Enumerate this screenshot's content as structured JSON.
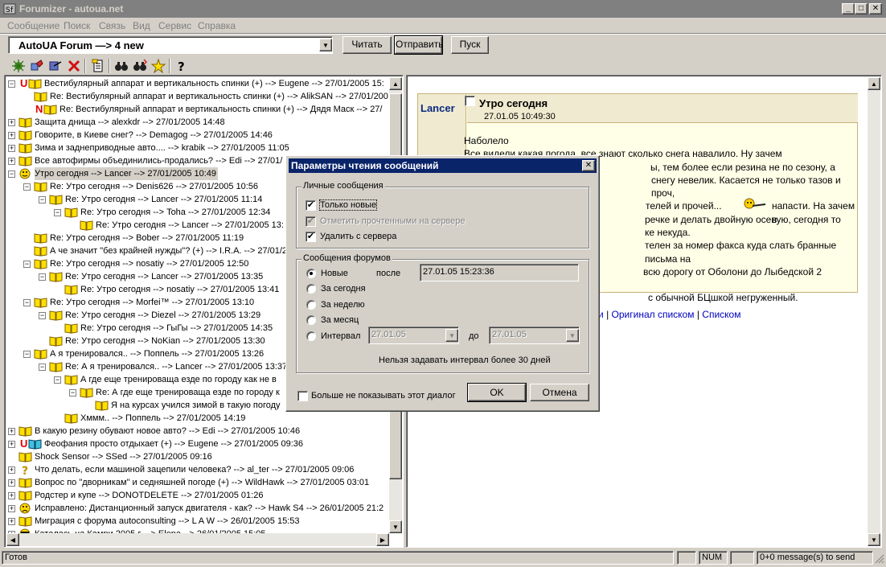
{
  "window": {
    "title": "Forumizer - autoua.net",
    "caption_buttons": [
      "_",
      "□",
      "✕"
    ]
  },
  "menu": [
    "Сообщение",
    "Поиск",
    "Связь",
    "Вид",
    "Сервис",
    "Справка"
  ],
  "toolbar": {
    "forum_select_value": "AutoUA Forum —> 4 new",
    "read_label": "Читать",
    "send_label": "Отправить",
    "start_label": "Пуск"
  },
  "tree": {
    "rows": [
      {
        "text": "Вестибулярный аппарат и вертикальность спинки (+) --> Eugene --> 27/01/2005 15:"
      },
      {
        "text": "Re: Вестибулярный аппарат и вертикальность спинки (+) --> AlikSAN --> 27/01/200"
      },
      {
        "text": "Re: Вестибулярный аппарат и вертикальность спинки (+) --> Дядя Маск --> 27/"
      },
      {
        "text": "Защита днища --> alexkdr --> 27/01/2005 14:48"
      },
      {
        "text": "Говорите, в Киеве снег? --> Demagog --> 27/01/2005 14:46"
      },
      {
        "text": "Зима и заднеприводные авто.... --> krabik --> 27/01/2005 11:05"
      },
      {
        "text": "Все автофирмы объединились-продались? --> Edi --> 27/01/"
      },
      {
        "text": "Утро сегодня --> Lancer --> 27/01/2005 10:49"
      },
      {
        "text": "Re: Утро сегодня --> Denis626 --> 27/01/2005 10:56"
      },
      {
        "text": "Re: Утро сегодня --> Lancer --> 27/01/2005 11:14"
      },
      {
        "text": "Re: Утро сегодня --> Toha --> 27/01/2005 12:34"
      },
      {
        "text": "Re: Утро сегодня --> Lancer --> 27/01/2005 13:"
      },
      {
        "text": "Re: Утро сегодня --> Bober --> 27/01/2005 11:19"
      },
      {
        "text": "А че значит \"без крайней нужды\"? (+) --> I.R.A. --> 27/01/2"
      },
      {
        "text": "Re: Утро сегодня --> nosatiy --> 27/01/2005 12:50"
      },
      {
        "text": "Re: Утро сегодня --> Lancer --> 27/01/2005 13:35"
      },
      {
        "text": "Re: Утро сегодня --> nosatiy --> 27/01/2005 13:41"
      },
      {
        "text": "Re: Утро сегодня --> Morfei™ --> 27/01/2005 13:10"
      },
      {
        "text": "Re: Утро сегодня --> Diezel --> 27/01/2005 13:29"
      },
      {
        "text": "Re: Утро сегодня --> ГыГы --> 27/01/2005 14:35"
      },
      {
        "text": "Re: Утро сегодня --> NoKian --> 27/01/2005 13:30"
      },
      {
        "text": "А я тренировался.. --> Поппель --> 27/01/2005 13:26"
      },
      {
        "text": "Re: А я тренировался.. --> Lancer --> 27/01/2005 13:37"
      },
      {
        "text": "А где еще тренироваща езде по городу как не в"
      },
      {
        "text": "Re: А где еще тренироваща езде по городу к"
      },
      {
        "text": "Я на курсах учился зимой в такую погоду"
      },
      {
        "text": "Хммм.. --> Поппель --> 27/01/2005 14:19"
      },
      {
        "text": "В какую резину обувают новое авто? --> Edi --> 27/01/2005 10:46"
      },
      {
        "text": "Феофания просто отдыхает (+) --> Eugene --> 27/01/2005 09:36"
      },
      {
        "text": "Shock Sensor --> SSed --> 27/01/2005 09:16"
      },
      {
        "text": "Что делать, если машиной зацепили человека? --> al_ter --> 27/01/2005 09:06"
      },
      {
        "text": "Вопрос по \"дворникам\" и седняшней погоде (+) --> WildHawk --> 27/01/2005 03:01"
      },
      {
        "text": "Родстер и купе --> DONOTDELETE --> 27/01/2005 01:26"
      },
      {
        "text": "Исправлено: Дистанционный запуск двигателя - как? --> Hawk S4 --> 26/01/2005 21:2"
      },
      {
        "text": "Миграция с форума autoconsulting --> L A W --> 26/01/2005 15:53"
      },
      {
        "text": "Каталась на Камри 2005 г. --> Elena --> 26/01/2005 15:05"
      }
    ],
    "markers": {
      "u": "U",
      "n": "N"
    }
  },
  "viewer": {
    "author": "Lancer",
    "subject": "Утро сегодня",
    "date": "27.01.05 10:49:30",
    "body_lines": [
      "Наболело",
      "Все видели какая погода, все знают сколько снега навалило. Ну зачем",
      "ы, тем более если резина не по сезону, а",
      "снегу невелик. Касается не только тазов и проч,",
      "телей и прочей...",
      "напасти. На зачем в",
      "речке и делать двойную осевую, сегодня то",
      "ке некуда.",
      "телен за номер факса куда слать бранные письма на",
      "всю дорогу от Оболони до Лыбедской 2",
      "с обычной БЦшкой негруженный."
    ],
    "links": {
      "a": "ли",
      "sep1": "|",
      "b": "Оригинал списком",
      "sep2": "|",
      "c": "Списком"
    }
  },
  "dialog": {
    "title": "Параметры чтения сообщений",
    "personal_group": "Личные сообщения",
    "only_new": "Только новые",
    "mark_read": "Отметить прочтенными на сервере",
    "delete_server": "Удалить с сервера",
    "forum_group": "Сообщения форумов",
    "opt_new": "Новые",
    "after_label": "после",
    "after_value": "27.01.05 15:23:36",
    "opt_today": "За сегодня",
    "opt_week": "За неделю",
    "opt_month": "За месяц",
    "opt_interval": "Интервал",
    "interval_from": "27.01.05",
    "to_label": "до",
    "interval_to": "27.01.05",
    "note": "Нельзя задавать интервал более 30 дней",
    "dont_show": "Больше не показывать этот диалог",
    "ok": "OK",
    "cancel": "Отмена"
  },
  "status": {
    "left": "Готов",
    "num": "NUM",
    "messages": "0+0 message(s) to send"
  }
}
